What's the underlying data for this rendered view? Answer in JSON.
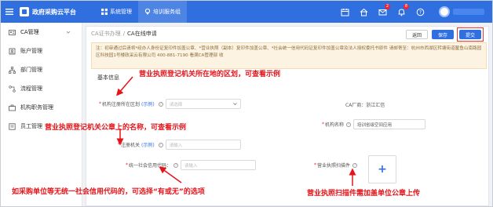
{
  "app": {
    "name": "政府采购云平台"
  },
  "topnav": [
    {
      "label": "系统管理",
      "icon": "grid-icon"
    },
    {
      "label": "培训服务组",
      "icon": "location-pin-icon"
    }
  ],
  "tools": [
    {
      "icon": "calendar-icon",
      "badge": ""
    },
    {
      "icon": "home-icon",
      "badge": ""
    },
    {
      "icon": "mail-icon",
      "badge": "2"
    },
    {
      "icon": "bell-icon",
      "badge": "8"
    },
    {
      "icon": "help-icon",
      "badge": ""
    }
  ],
  "sidebar": {
    "items": [
      {
        "label": "CA管理",
        "icon": "id-card-icon"
      },
      {
        "label": "账户管理",
        "icon": "user-icon"
      },
      {
        "label": "部门管理",
        "icon": "org-icon"
      },
      {
        "label": "流程管理",
        "icon": "flow-icon"
      },
      {
        "label": "机构职务管理",
        "icon": "briefcase-icon"
      },
      {
        "label": "员工管理",
        "icon": "people-icon"
      }
    ]
  },
  "breadcrumb": {
    "parent": "CA证书办理",
    "sep": "/",
    "current": "CA在线申请"
  },
  "actions": {
    "return": "返回",
    "save": "保存",
    "submit": "提交"
  },
  "notice": "注：初审通过后请将*经办人身份证复印件加盖公章、*营业执照（副本）复印件加盖公章、*社会统一信用代码证复印件加盖公章及法人授权委托书原件 请邮寄至：杭州市西湖区转塘街道鳌鱼山南路园区科技园1号楼政采云有限公司 400-881-7190 看满CA管理部 收",
  "form": {
    "section": "基本信息",
    "region": {
      "label": "机构注册所在区划",
      "example": "(示例)",
      "placeholder": "请选择"
    },
    "ca_factory": {
      "label": "CA厂商：",
      "value": "浙江汇信"
    },
    "org_name": {
      "label": "机构名称",
      "value": "培训省级空间应用"
    },
    "authority": {
      "label": "注册机关",
      "example": "(示例)",
      "placeholder": "请输入"
    },
    "credit_code": {
      "label": "统一社会信用代码：",
      "placeholder": "请输入"
    },
    "license_scan": {
      "label": "营业执照扫描件"
    }
  },
  "annotations": {
    "a1": "营业执照登记机关所在地的区划，可查看示例",
    "a2": "营业执照登记机关公章上的名称，可查看示例",
    "a3": "如采购单位等无统一社会信用代码的，可选择“有或无”的选项",
    "a4": "营业执照扫描件需加盖单位公章上传"
  },
  "colors": {
    "brand": "#2f6fe0",
    "annotation": "#e4151a",
    "notice_bg": "#fdf3e3"
  }
}
